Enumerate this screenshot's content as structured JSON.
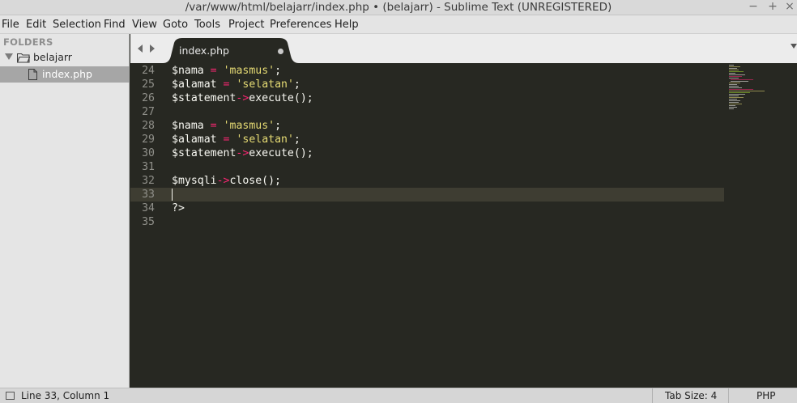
{
  "window": {
    "title": "/var/www/html/belajarr/index.php • (belajarr) - Sublime Text (UNREGISTERED)",
    "controls": {
      "minimize": "−",
      "maximize": "+",
      "close": "×"
    }
  },
  "menubar": {
    "items": [
      "File",
      "Edit",
      "Selection",
      "Find",
      "View",
      "Goto",
      "Tools",
      "Project",
      "Preferences",
      "Help"
    ]
  },
  "sidebar": {
    "header": "FOLDERS",
    "folder": "belajarr",
    "file": "index.php"
  },
  "tabs": {
    "active": "index.php",
    "modified": true
  },
  "editor": {
    "current_line": 33,
    "lines": [
      {
        "num": "24",
        "tokens": [
          [
            "var",
            "$nama"
          ],
          [
            "plain",
            " "
          ],
          [
            "op",
            "="
          ],
          [
            "plain",
            " "
          ],
          [
            "str",
            "'masmus'"
          ],
          [
            "plain",
            ";"
          ]
        ]
      },
      {
        "num": "25",
        "tokens": [
          [
            "var",
            "$alamat"
          ],
          [
            "plain",
            " "
          ],
          [
            "op",
            "="
          ],
          [
            "plain",
            " "
          ],
          [
            "str",
            "'selatan'"
          ],
          [
            "plain",
            ";"
          ]
        ]
      },
      {
        "num": "26",
        "tokens": [
          [
            "var",
            "$statement"
          ],
          [
            "op",
            "->"
          ],
          [
            "fn",
            "execute"
          ],
          [
            "plain",
            "();"
          ]
        ]
      },
      {
        "num": "27",
        "tokens": []
      },
      {
        "num": "28",
        "tokens": [
          [
            "var",
            "$nama"
          ],
          [
            "plain",
            " "
          ],
          [
            "op",
            "="
          ],
          [
            "plain",
            " "
          ],
          [
            "str",
            "'masmus'"
          ],
          [
            "plain",
            ";"
          ]
        ]
      },
      {
        "num": "29",
        "tokens": [
          [
            "var",
            "$alamat"
          ],
          [
            "plain",
            " "
          ],
          [
            "op",
            "="
          ],
          [
            "plain",
            " "
          ],
          [
            "str",
            "'selatan'"
          ],
          [
            "plain",
            ";"
          ]
        ]
      },
      {
        "num": "30",
        "tokens": [
          [
            "var",
            "$statement"
          ],
          [
            "op",
            "->"
          ],
          [
            "fn",
            "execute"
          ],
          [
            "plain",
            "();"
          ]
        ]
      },
      {
        "num": "31",
        "tokens": []
      },
      {
        "num": "32",
        "tokens": [
          [
            "var",
            "$mysqli"
          ],
          [
            "op",
            "->"
          ],
          [
            "fn",
            "close"
          ],
          [
            "plain",
            "();"
          ]
        ]
      },
      {
        "num": "33",
        "tokens": []
      },
      {
        "num": "34",
        "tokens": [
          [
            "plain",
            "?>"
          ]
        ]
      },
      {
        "num": "35",
        "tokens": []
      }
    ]
  },
  "statusbar": {
    "position": "Line 33, Column 1",
    "tab_size": "Tab Size: 4",
    "syntax": "PHP"
  },
  "colors": {
    "editor_bg": "#272822",
    "keyword_op": "#f92672",
    "string": "#e6db74",
    "text": "#f8f8f2",
    "gutter": "#90908a",
    "current_line": "#3e3d32"
  }
}
